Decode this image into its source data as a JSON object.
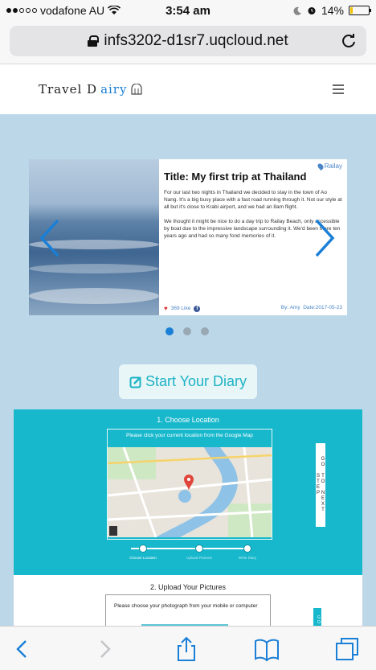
{
  "status_bar": {
    "carrier": "vodafone AU",
    "time": "3:54 am",
    "battery_percent": "14%",
    "battery_level": 0.14
  },
  "browser": {
    "url": "infs3202-d1sr7.uqcloud.net"
  },
  "site": {
    "logo_part1": "Travel D",
    "logo_part2": "airy"
  },
  "carousel": {
    "location": "Railay",
    "title": "Title: My first trip at Thailand",
    "paragraph1": "For our last two nights in Thailand we decided to stay in the town of Ao Nang. It's a big busy place with a fast road running through it. Not our style at all but it's close to Krabi airport, and we had an 8am flight.",
    "paragraph2": "We thought it might be nice to do a day trip to Railay Beach, only accessible by boat due to the impressive landscape surrounding it. We'd been there ten years ago and had so many fond memories of it.",
    "likes": "369 Like",
    "author": "By: Amy",
    "date": "Date:2017-05-23",
    "active_dot": 0,
    "dot_count": 3
  },
  "cta": {
    "label": "Start Your Diary"
  },
  "step1": {
    "title": "1. Choose Location",
    "map_caption": "Please click your current location from the Google Map",
    "next_step_label": "GO TO NEXT STEP",
    "progress_labels": [
      "Choose Location",
      "Upload Pictures",
      "Write Diary"
    ]
  },
  "step2": {
    "title": "2. Upload Your Pictures",
    "instruction": "Please choose your photograph from your mobile or computer",
    "go_label": "GO"
  },
  "colors": {
    "accent": "#18b8cc",
    "link_blue": "#1a7fd6",
    "page_bg": "#bcd8e8"
  }
}
